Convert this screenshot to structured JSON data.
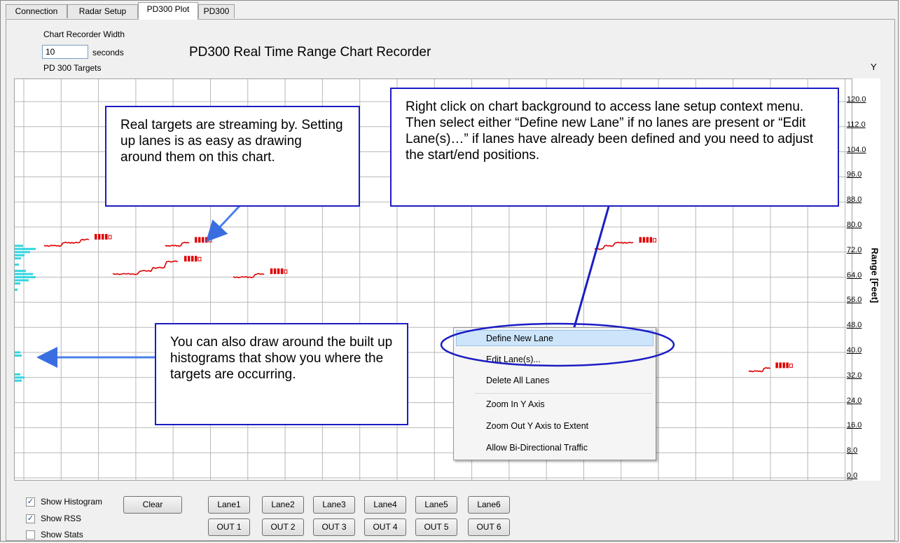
{
  "tabs": [
    {
      "label": "Connection"
    },
    {
      "label": "Radar Setup"
    },
    {
      "label": "PD300 Plot"
    },
    {
      "label": "PD300"
    }
  ],
  "settings": {
    "width_label": "Chart Recorder Width",
    "width_value": "10",
    "width_unit": "seconds",
    "targets_label": "PD 300 Targets"
  },
  "chart": {
    "title": "PD300 Real Time Range Chart Recorder",
    "y_letter": "Y",
    "ylabel": "Range [Feet]",
    "ticks": [
      "120.0",
      "112.0",
      "104.0",
      "96.0",
      "88.0",
      "80.0",
      "72.0",
      "64.0",
      "56.0",
      "48.0",
      "40.0",
      "32.0",
      "24.0",
      "16.0",
      "8.0",
      "0.0"
    ]
  },
  "chart_data": {
    "type": "line",
    "title": "PD300 Real Time Range Chart Recorder",
    "ylabel": "Range [Feet]",
    "ylim": [
      0,
      120
    ],
    "grid": true,
    "series": [
      {
        "values": [
          74,
          74,
          75,
          75,
          76
        ]
      },
      {
        "values": [
          74,
          74,
          75
        ]
      },
      {
        "values": [
          65,
          65,
          66,
          67,
          69
        ]
      },
      {
        "values": [
          64,
          64,
          65
        ]
      },
      {
        "values": [
          73,
          74,
          75,
          75
        ]
      },
      {
        "values": [
          34,
          34,
          35
        ]
      }
    ]
  },
  "callouts": {
    "targets": "Real targets are streaming by. Setting up lanes is as easy as drawing around them on this chart.",
    "histogram": "You can also draw around the built up histograms that show you where the targets are occurring.",
    "context_line1": "Right click on chart background to access lane setup context menu.",
    "context_line2": "Then select either “Define new Lane” if no lanes are present or “Edit Lane(s)…” if lanes have already been defined and you need to adjust the start/end positions."
  },
  "context_menu": {
    "items": [
      {
        "label": "Define New Lane"
      },
      {
        "label": "Edit Lane(s)..."
      },
      {
        "label": "Delete All Lanes"
      },
      {
        "label": "Zoom In Y Axis"
      },
      {
        "label": "Zoom Out Y Axis to Extent"
      },
      {
        "label": "Allow Bi-Directional Traffic"
      }
    ]
  },
  "controls": {
    "show_histogram": "Show Histogram",
    "show_rss": "Show RSS",
    "show_stats": "Show Stats",
    "clear": "Clear",
    "lanes": [
      "Lane1",
      "Lane2",
      "Lane3",
      "Lane4",
      "Lane5",
      "Lane6"
    ],
    "outs": [
      "OUT 1",
      "OUT 2",
      "OUT 3",
      "OUT 4",
      "OUT 5",
      "OUT 6"
    ]
  },
  "colors": {
    "trace": "#e00000",
    "histogram": "#33d6e0",
    "callout_border": "#1c1cc4",
    "arrow": "#4a7fe8"
  }
}
